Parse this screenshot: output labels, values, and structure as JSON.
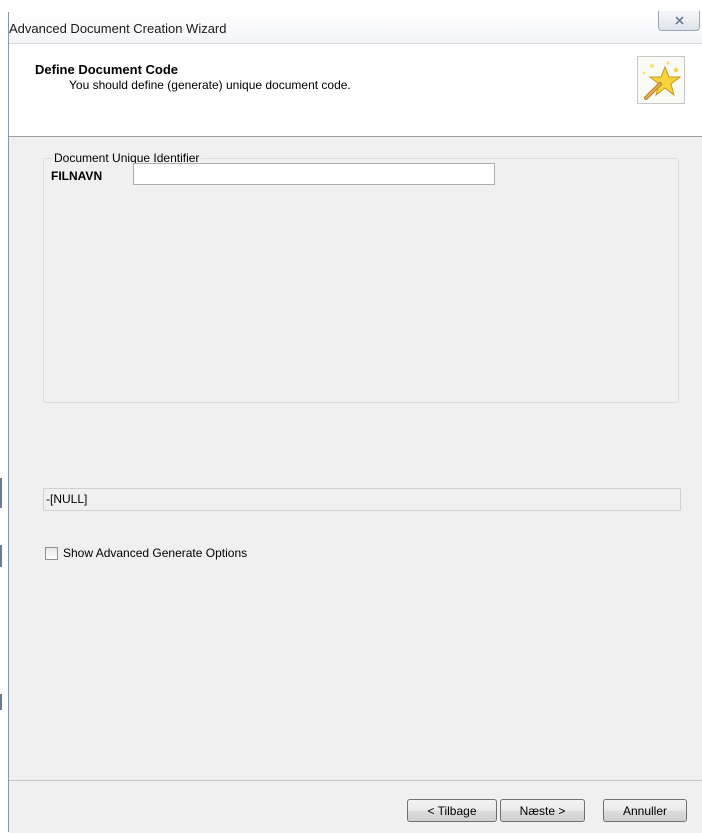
{
  "window": {
    "title": "Advanced Document Creation Wizard"
  },
  "header": {
    "title": "Define Document Code",
    "subtitle": "You should define (generate) unique document code."
  },
  "identifier_group": {
    "legend": "Document Unique Identifier",
    "field_label": "FILNAVN",
    "field_value": ""
  },
  "preview": {
    "value": "-[NULL]"
  },
  "advanced_options": {
    "label": "Show Advanced Generate Options",
    "checked": false
  },
  "buttons": {
    "back": "< Tilbage",
    "next": "Næste >",
    "cancel": "Annuller"
  },
  "icons": {
    "close": "close-icon",
    "wizard": "magic-wand-star-icon"
  }
}
